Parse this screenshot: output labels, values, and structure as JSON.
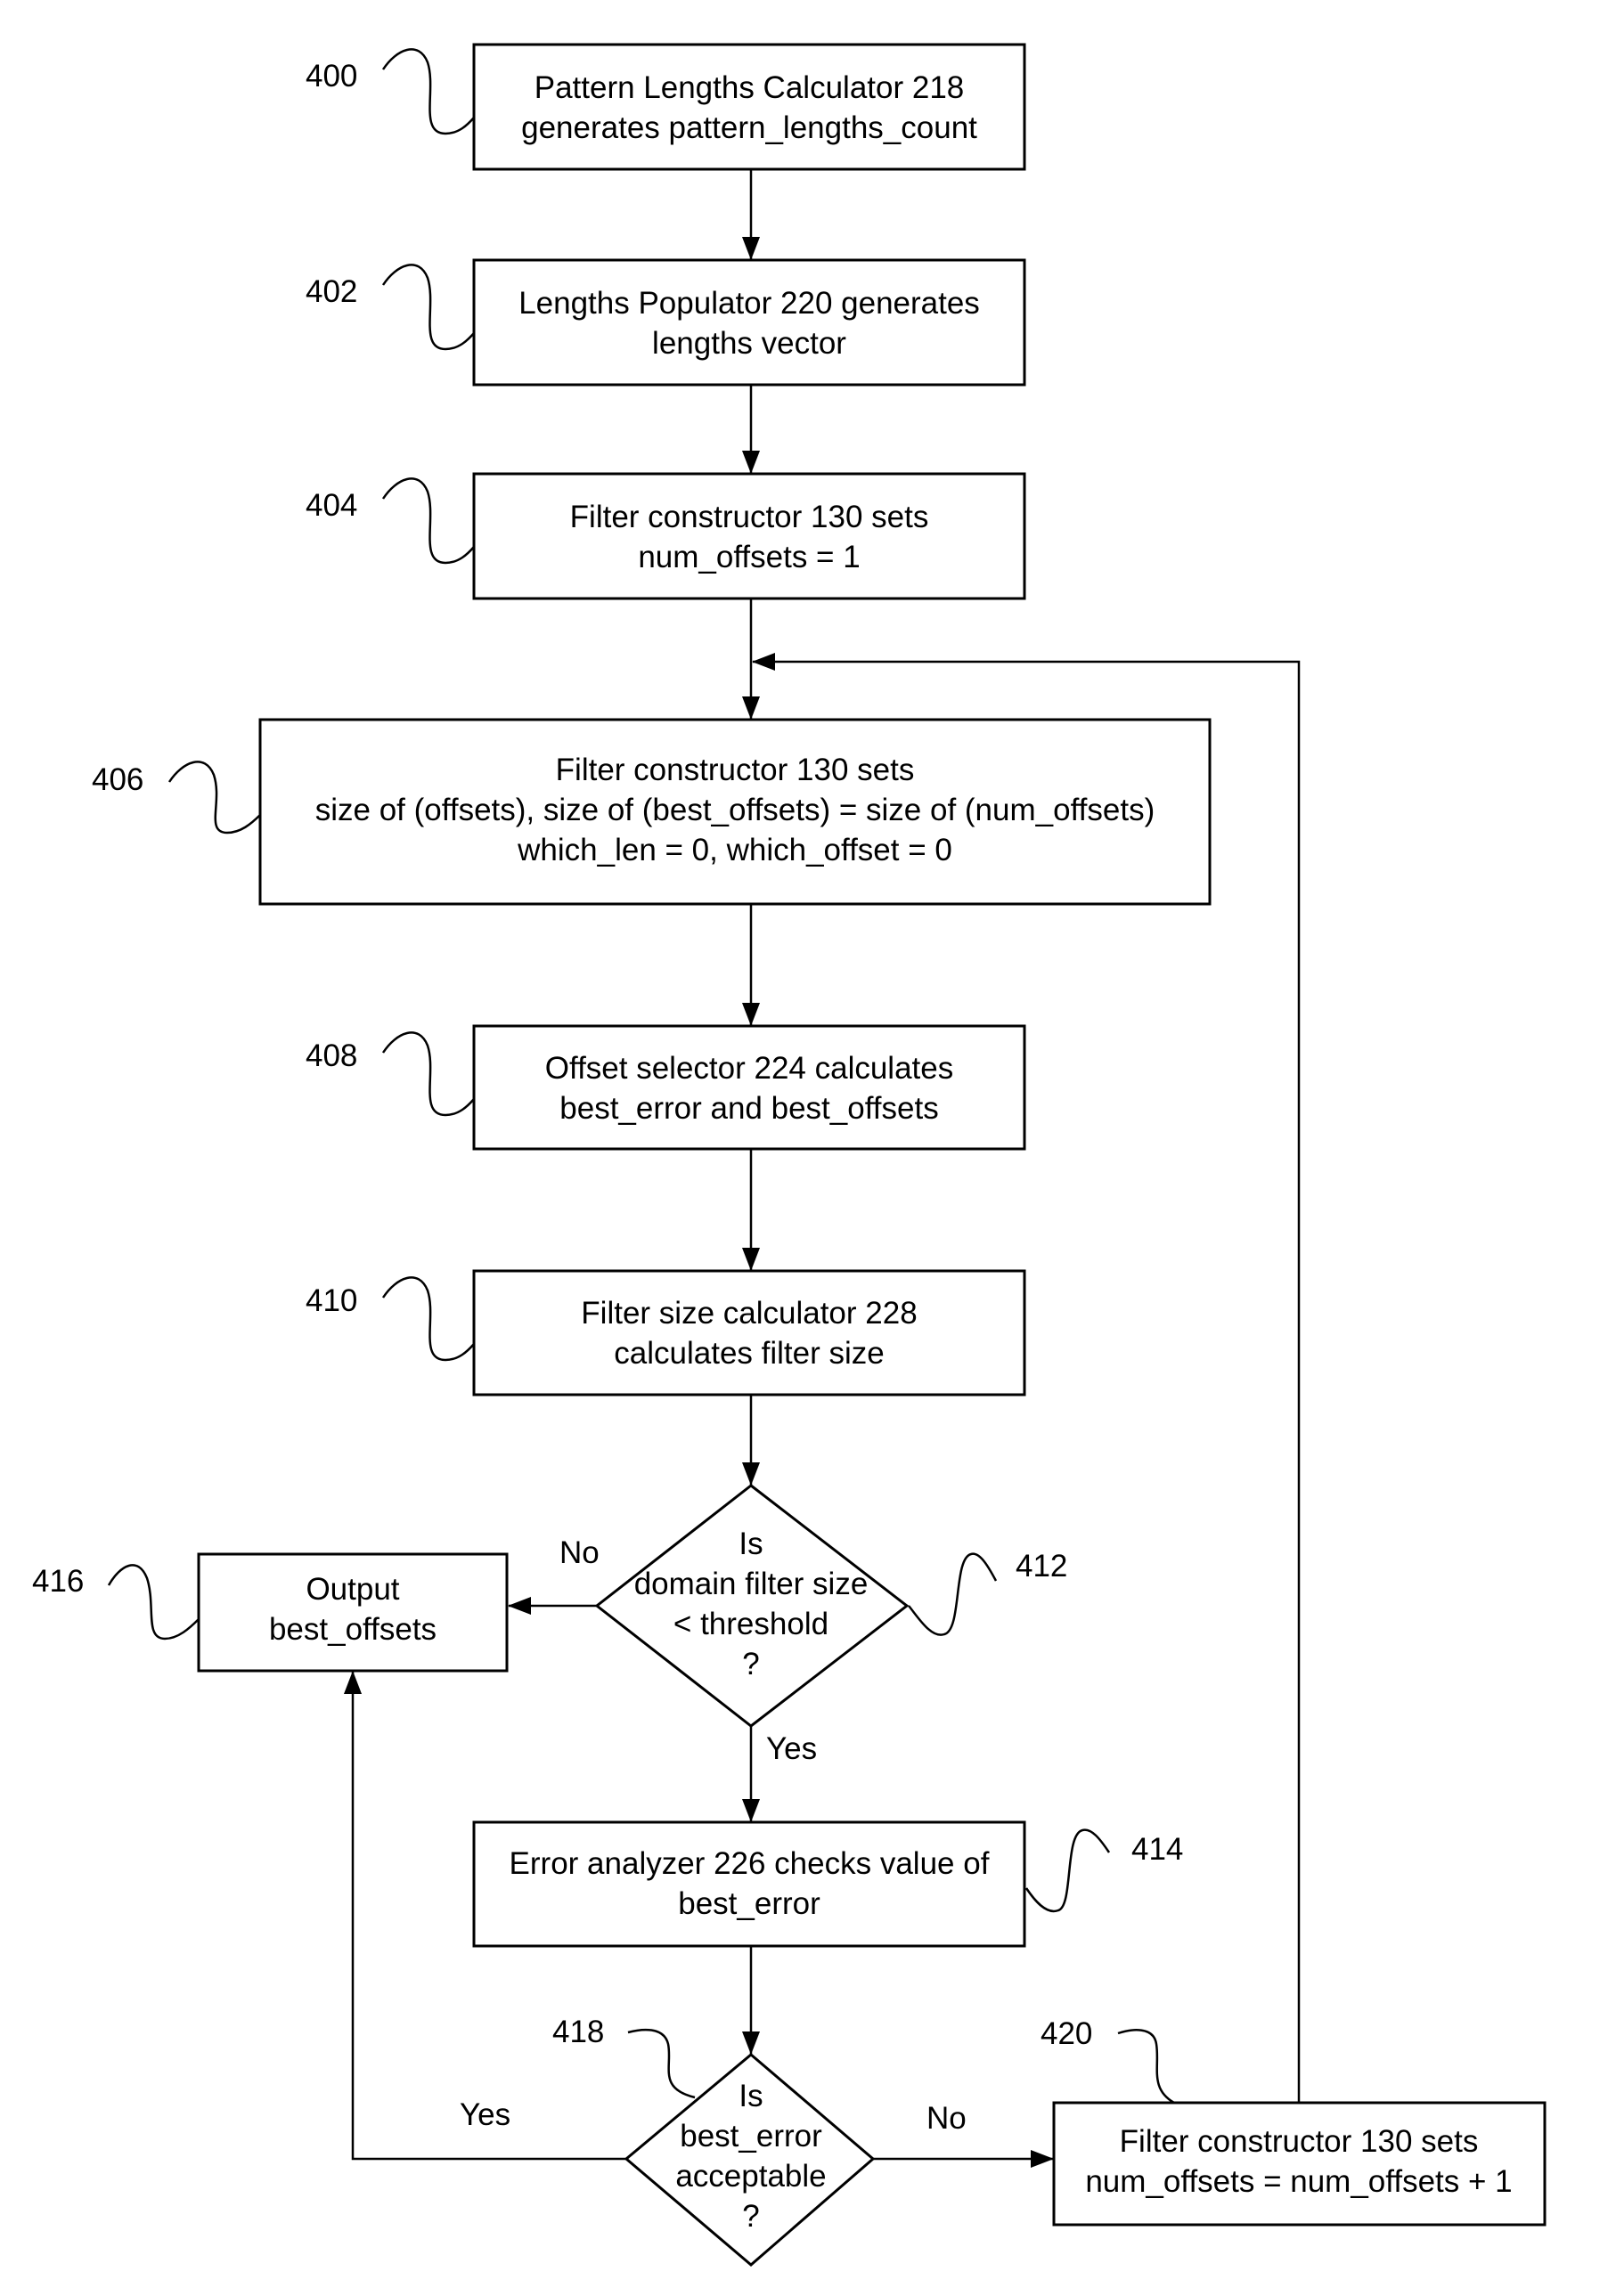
{
  "figure": {
    "nodes": [
      {
        "id": "400",
        "type": "process",
        "lines": [
          "Pattern Lengths Calculator 218",
          "generates pattern_lengths_count"
        ]
      },
      {
        "id": "402",
        "type": "process",
        "lines": [
          "Lengths Populator 220 generates",
          "lengths vector"
        ]
      },
      {
        "id": "404",
        "type": "process",
        "lines": [
          "Filter constructor 130 sets",
          "num_offsets = 1"
        ]
      },
      {
        "id": "406",
        "type": "process",
        "lines": [
          "Filter constructor 130 sets",
          "size of (offsets), size of (best_offsets) = size of (num_offsets)",
          "which_len = 0, which_offset = 0"
        ]
      },
      {
        "id": "408",
        "type": "process",
        "lines": [
          "Offset selector 224 calculates",
          "best_error and best_offsets"
        ]
      },
      {
        "id": "410",
        "type": "process",
        "lines": [
          "Filter size calculator 228",
          "calculates filter size"
        ]
      },
      {
        "id": "412",
        "type": "decision",
        "lines": [
          "Is",
          "domain filter size",
          "< threshold",
          "?"
        ]
      },
      {
        "id": "414",
        "type": "process",
        "lines": [
          "Error analyzer 226 checks value of",
          "best_error"
        ]
      },
      {
        "id": "416",
        "type": "process",
        "lines": [
          "Output",
          "best_offsets"
        ]
      },
      {
        "id": "418",
        "type": "decision",
        "lines": [
          "Is",
          "best_error",
          "acceptable",
          "?"
        ]
      },
      {
        "id": "420",
        "type": "process",
        "lines": [
          "Filter constructor 130 sets",
          "num_offsets = num_offsets + 1"
        ]
      }
    ],
    "edge_labels": {
      "e412_no": "No",
      "e412_yes": "Yes",
      "e418_yes": "Yes",
      "e418_no": "No"
    },
    "edges": [
      {
        "from": "400",
        "to": "402"
      },
      {
        "from": "402",
        "to": "404"
      },
      {
        "from": "404",
        "to": "406"
      },
      {
        "from": "406",
        "to": "408"
      },
      {
        "from": "408",
        "to": "410"
      },
      {
        "from": "410",
        "to": "412"
      },
      {
        "from": "412",
        "to": "416",
        "label": "No"
      },
      {
        "from": "412",
        "to": "414",
        "label": "Yes"
      },
      {
        "from": "414",
        "to": "418"
      },
      {
        "from": "418",
        "to": "416",
        "label": "Yes"
      },
      {
        "from": "418",
        "to": "420",
        "label": "No"
      },
      {
        "from": "420",
        "to": "406"
      }
    ]
  }
}
